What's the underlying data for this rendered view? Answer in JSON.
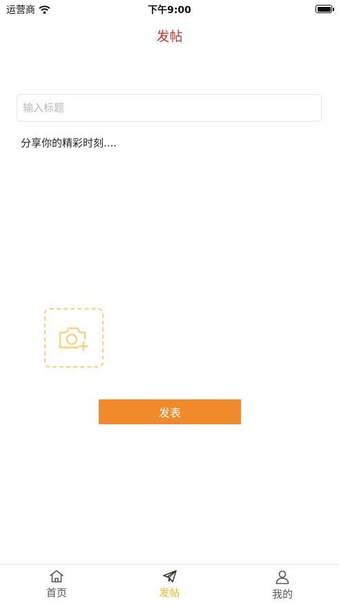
{
  "status_bar": {
    "carrier": "运营商",
    "time": "下午9:00"
  },
  "nav": {
    "title": "发帖"
  },
  "form": {
    "title_placeholder": "输入标题",
    "content_placeholder": "分享你的精彩时刻....",
    "photo_icon": "camera-plus-icon",
    "publish_label": "发表"
  },
  "tabbar": {
    "items": [
      {
        "label": "首页",
        "icon": "home-icon",
        "active": false
      },
      {
        "label": "发帖",
        "icon": "paper-plane-icon",
        "active": true
      },
      {
        "label": "我的",
        "icon": "user-icon",
        "active": false
      }
    ]
  },
  "colors": {
    "title_red": "#d6322f",
    "accent_orange": "#f08a2a",
    "active_tab_yellow": "#f5b81a",
    "dashed_border": "#f8d27c"
  }
}
